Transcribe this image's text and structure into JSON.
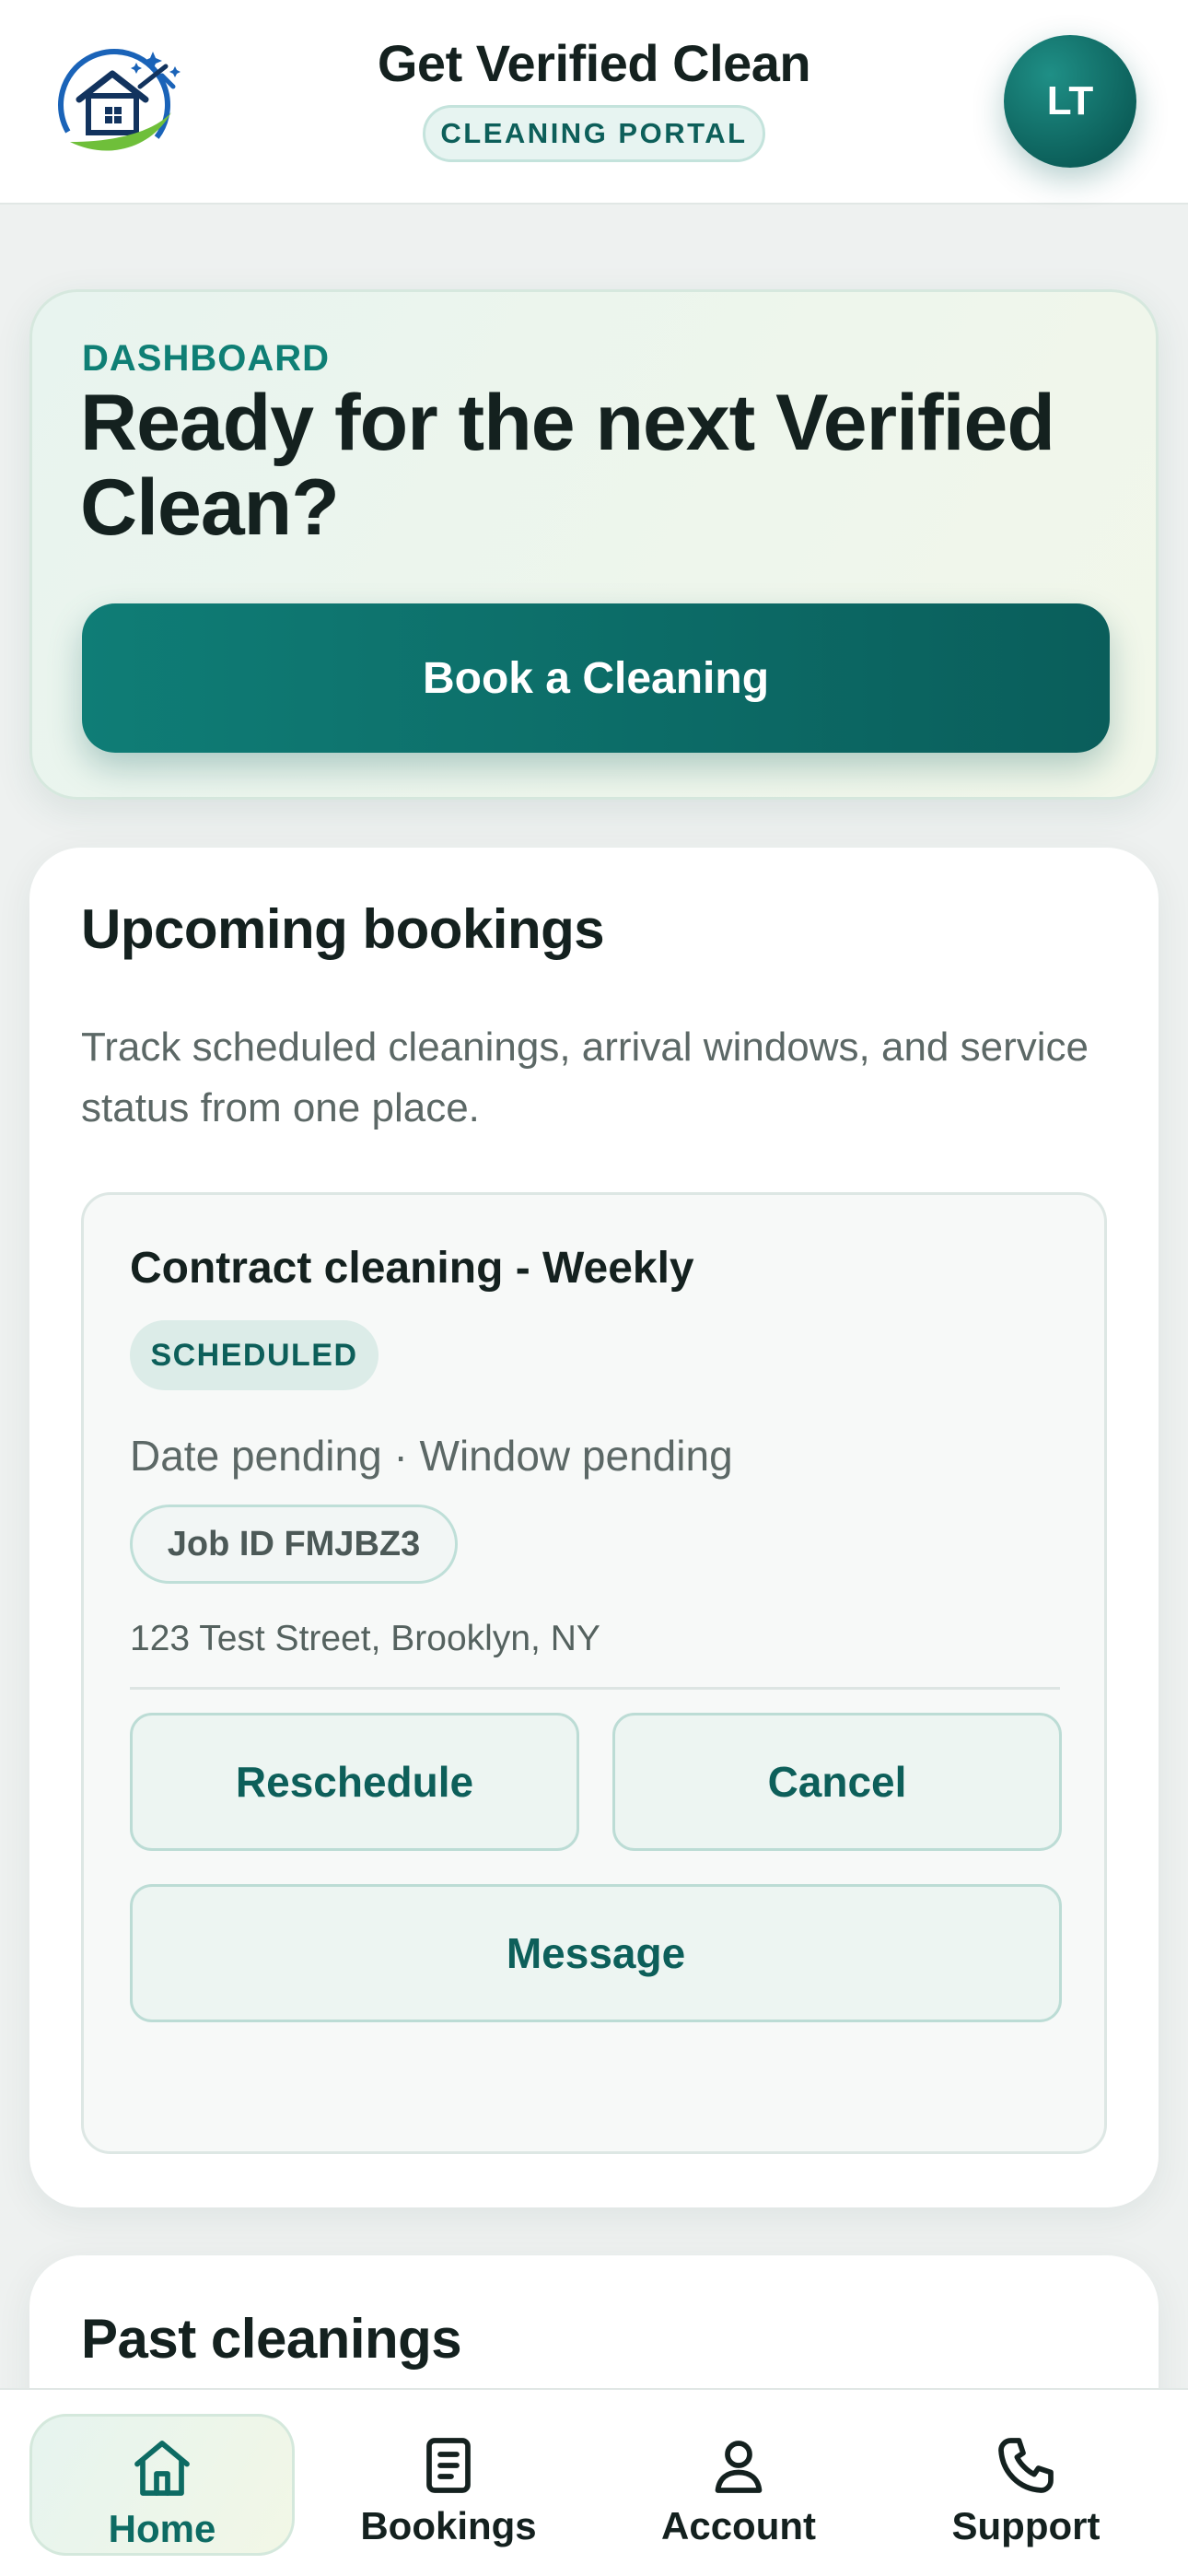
{
  "header": {
    "app_title": "Get Verified Clean",
    "portal_badge": "CLEANING PORTAL",
    "avatar_initials": "LT"
  },
  "hero": {
    "kicker": "DASHBOARD",
    "title": "Ready for the next Verified Clean?",
    "cta_label": "Book a Cleaning"
  },
  "upcoming": {
    "title": "Upcoming bookings",
    "description": "Track scheduled cleanings, arrival windows, and service status from one place.",
    "booking": {
      "name": "Contract cleaning - Weekly",
      "status": "SCHEDULED",
      "schedule": "Date pending · Window pending",
      "job_id": "Job ID FMJBZ3",
      "address": "123 Test Street, Brooklyn, NY",
      "actions": {
        "reschedule": "Reschedule",
        "cancel": "Cancel",
        "message": "Message"
      }
    }
  },
  "past": {
    "title": "Past cleanings"
  },
  "nav": {
    "items": [
      {
        "label": "Home",
        "icon": "home-icon",
        "active": true
      },
      {
        "label": "Bookings",
        "icon": "document-icon",
        "active": false
      },
      {
        "label": "Account",
        "icon": "user-icon",
        "active": false
      },
      {
        "label": "Support",
        "icon": "phone-icon",
        "active": false
      }
    ]
  },
  "colors": {
    "brand_teal": "#0d6b63",
    "accent_green": "#6fbf3a",
    "background": "#eef1f0"
  }
}
